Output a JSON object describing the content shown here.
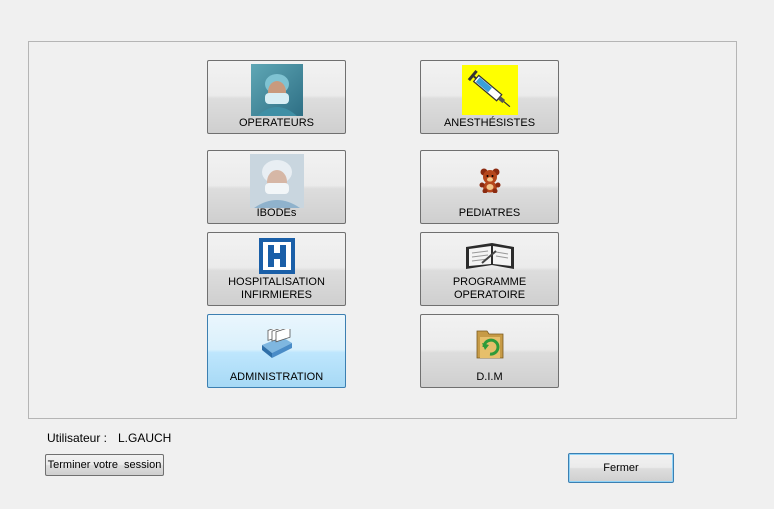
{
  "tiles": [
    {
      "label": "OPERATEURS",
      "icon": "surgeon-icon"
    },
    {
      "label": "ANESTHÉSISTES",
      "icon": "syringe-icon"
    },
    {
      "label": "IBODEs",
      "icon": "nurse-icon"
    },
    {
      "label": "PEDIATRES",
      "icon": "teddy-bear-icon"
    },
    {
      "label": "HOSPITALISATION\nINFIRMIERES",
      "icon": "hospital-h-icon"
    },
    {
      "label": "PROGRAMME\nOPERATOIRE",
      "icon": "agenda-icon"
    },
    {
      "label": "ADMINISTRATION",
      "icon": "card-file-icon"
    },
    {
      "label": "D.I.M",
      "icon": "folder-refresh-icon"
    }
  ],
  "user": {
    "caption": "Utilisateur :",
    "name": "L.GAUCH"
  },
  "buttons": {
    "end_session": "Terminer votre  session",
    "close": "Fermer"
  },
  "colors": {
    "hospital_blue": "#1a5fa8",
    "syringe_bg": "#ffff00",
    "focus_border": "#3c7fb1"
  }
}
